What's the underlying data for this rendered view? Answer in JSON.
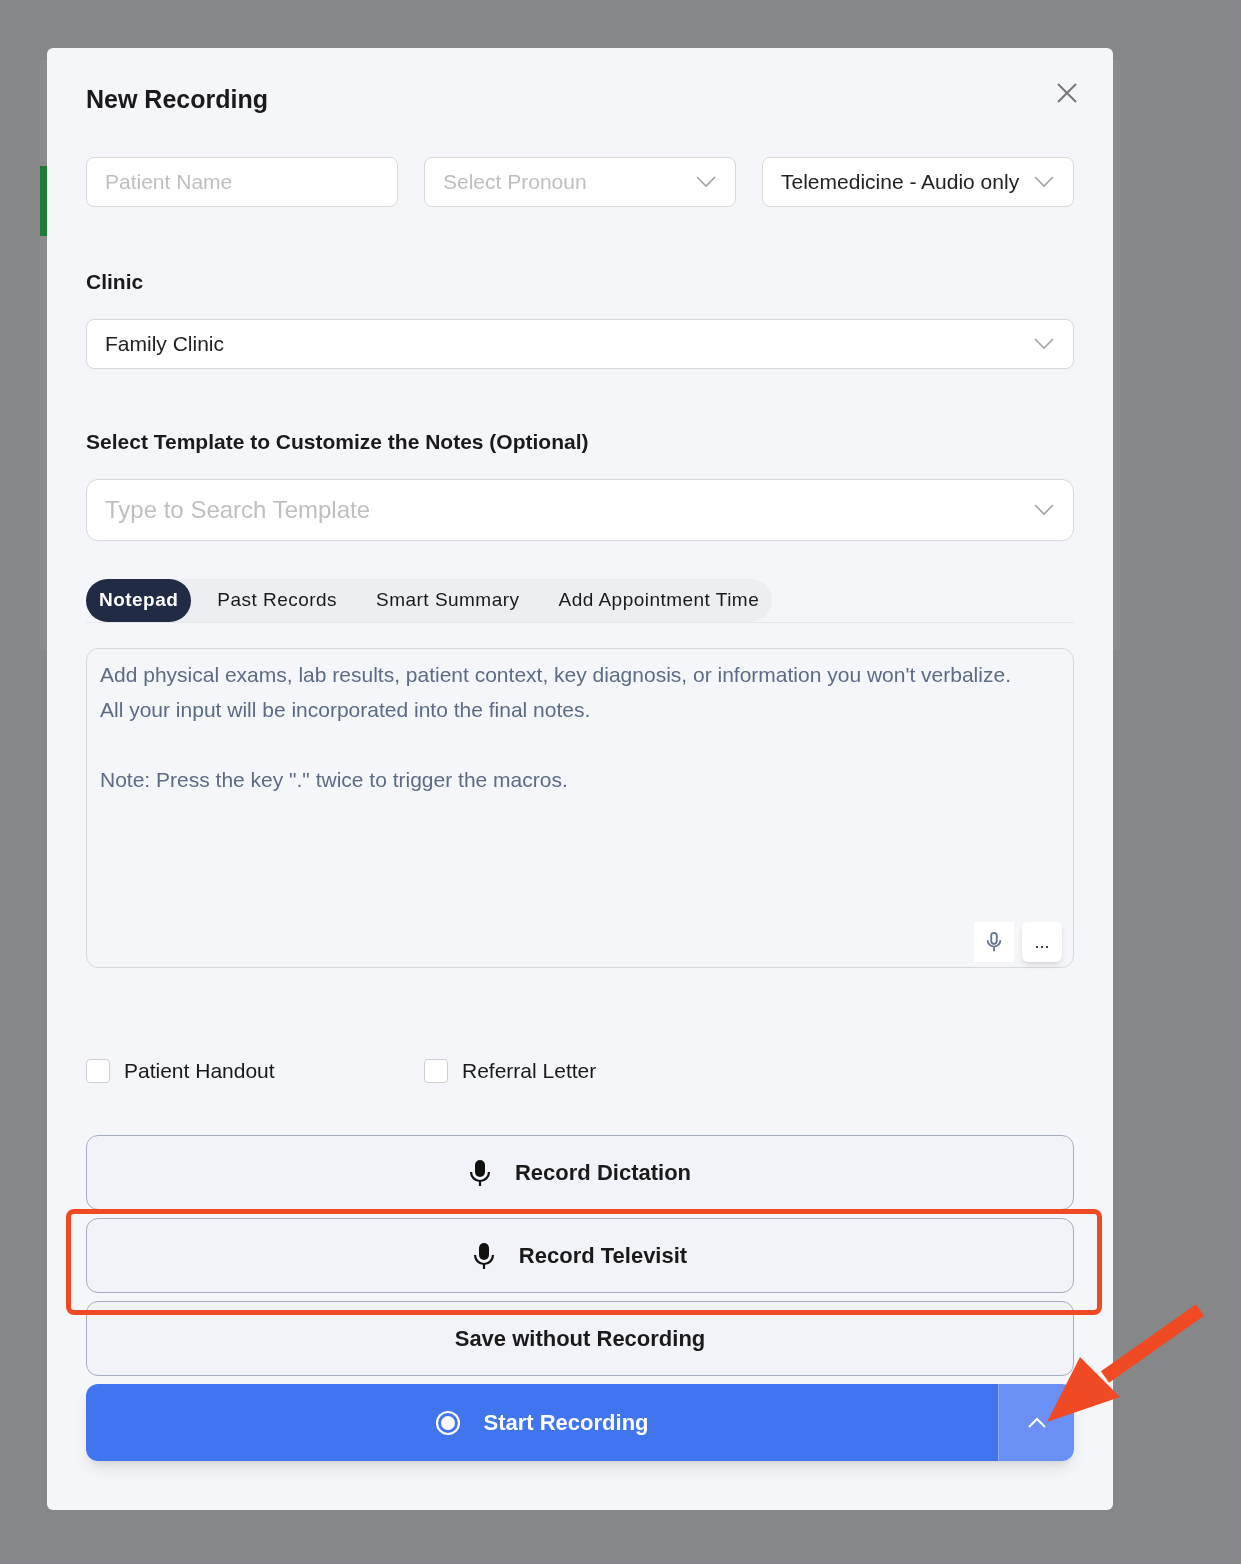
{
  "dialog": {
    "title": "New Recording"
  },
  "fields": [
    {
      "kind": "input",
      "placeholder": "Patient Name"
    },
    {
      "kind": "select",
      "placeholder": "Select Pronoun"
    },
    {
      "kind": "select",
      "value": "Telemedicine - Audio only"
    }
  ],
  "clinic": {
    "label": "Clinic",
    "value": "Family Clinic"
  },
  "template": {
    "label": "Select Template to Customize the Notes (Optional)",
    "placeholder": "Type to Search Template"
  },
  "tabs": [
    {
      "label": "Notepad",
      "selected": true
    },
    {
      "label": "Past Records",
      "selected": false
    },
    {
      "label": "Smart Summary",
      "selected": false
    },
    {
      "label": "Add Appointment Time",
      "selected": false
    }
  ],
  "notepad": {
    "placeholder": "Add physical exams, lab results, patient context, key diagnosis, or information you won't verbalize. All your input will be incorporated into the final notes.\n\nNote: Press the key \".\" twice to trigger the macros.",
    "more_label": "..."
  },
  "options": [
    {
      "label": "Patient Handout",
      "checked": false
    },
    {
      "label": "Referral Letter",
      "checked": false
    }
  ],
  "actions": [
    {
      "kind": "mic",
      "label": "Record Dictation",
      "highlighted": false
    },
    {
      "kind": "mic",
      "label": "Record Televisit",
      "highlighted": true
    },
    {
      "kind": "plain",
      "label": "Save without Recording",
      "highlighted": false
    }
  ],
  "primary": {
    "label": "Start Recording",
    "arrow_to_toggle": true
  }
}
